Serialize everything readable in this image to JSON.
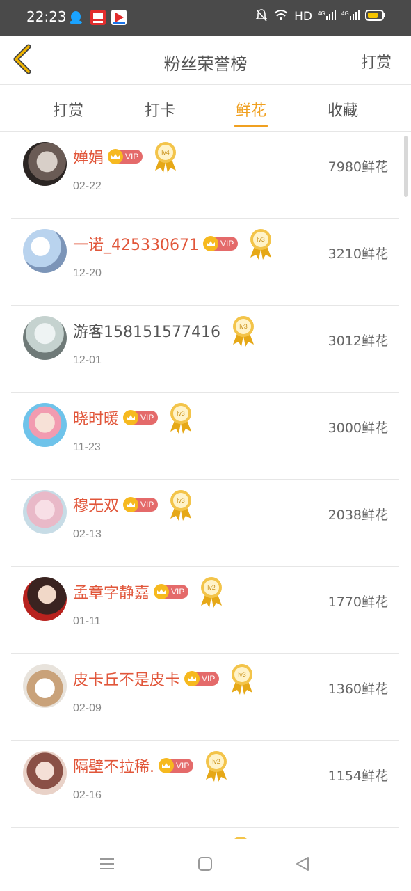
{
  "status_bar": {
    "time": "22:23",
    "right_text": "HD",
    "icons": [
      "qq-icon",
      "news-app-icon",
      "video-app-icon",
      "mute-bell-icon",
      "wifi-icon",
      "hd-icon",
      "signal-4g-icon",
      "signal-4g-icon",
      "battery-icon"
    ],
    "battery_color": "#f5c400"
  },
  "header": {
    "title": "粉丝荣誉榜",
    "action": "打赏",
    "back_icon": "chevron-left-icon",
    "accent_color": "#f0b400"
  },
  "tabs": [
    {
      "label": "打赏",
      "active": false
    },
    {
      "label": "打卡",
      "active": false
    },
    {
      "label": "鲜花",
      "active": true
    },
    {
      "label": "收藏",
      "active": false
    }
  ],
  "vip_label": "VIP",
  "fans": [
    {
      "name": "婵娟",
      "vip": true,
      "level": "lv4",
      "date": "02-22",
      "flowers": "7980鲜花"
    },
    {
      "name": "一诺_425330671",
      "vip": true,
      "level": "lv3",
      "date": "12-20",
      "flowers": "3210鲜花"
    },
    {
      "name": "游客158151577416",
      "vip": false,
      "level": "lv3",
      "date": "12-01",
      "flowers": "3012鲜花"
    },
    {
      "name": "晓时暖",
      "vip": true,
      "level": "lv3",
      "date": "11-23",
      "flowers": "3000鲜花"
    },
    {
      "name": "穆无双",
      "vip": true,
      "level": "lv3",
      "date": "02-13",
      "flowers": "2038鲜花"
    },
    {
      "name": "孟章字静嘉",
      "vip": true,
      "level": "lv2",
      "date": "01-11",
      "flowers": "1770鲜花"
    },
    {
      "name": "皮卡丘不是皮卡",
      "vip": true,
      "level": "lv3",
      "date": "02-09",
      "flowers": "1360鲜花"
    },
    {
      "name": "隔壁不拉稀.",
      "vip": true,
      "level": "lv2",
      "date": "02-16",
      "flowers": "1154鲜花"
    }
  ],
  "nav": {
    "menu_icon": "menu-icon",
    "home_icon": "home-square-icon",
    "back_icon": "back-triangle-icon"
  }
}
